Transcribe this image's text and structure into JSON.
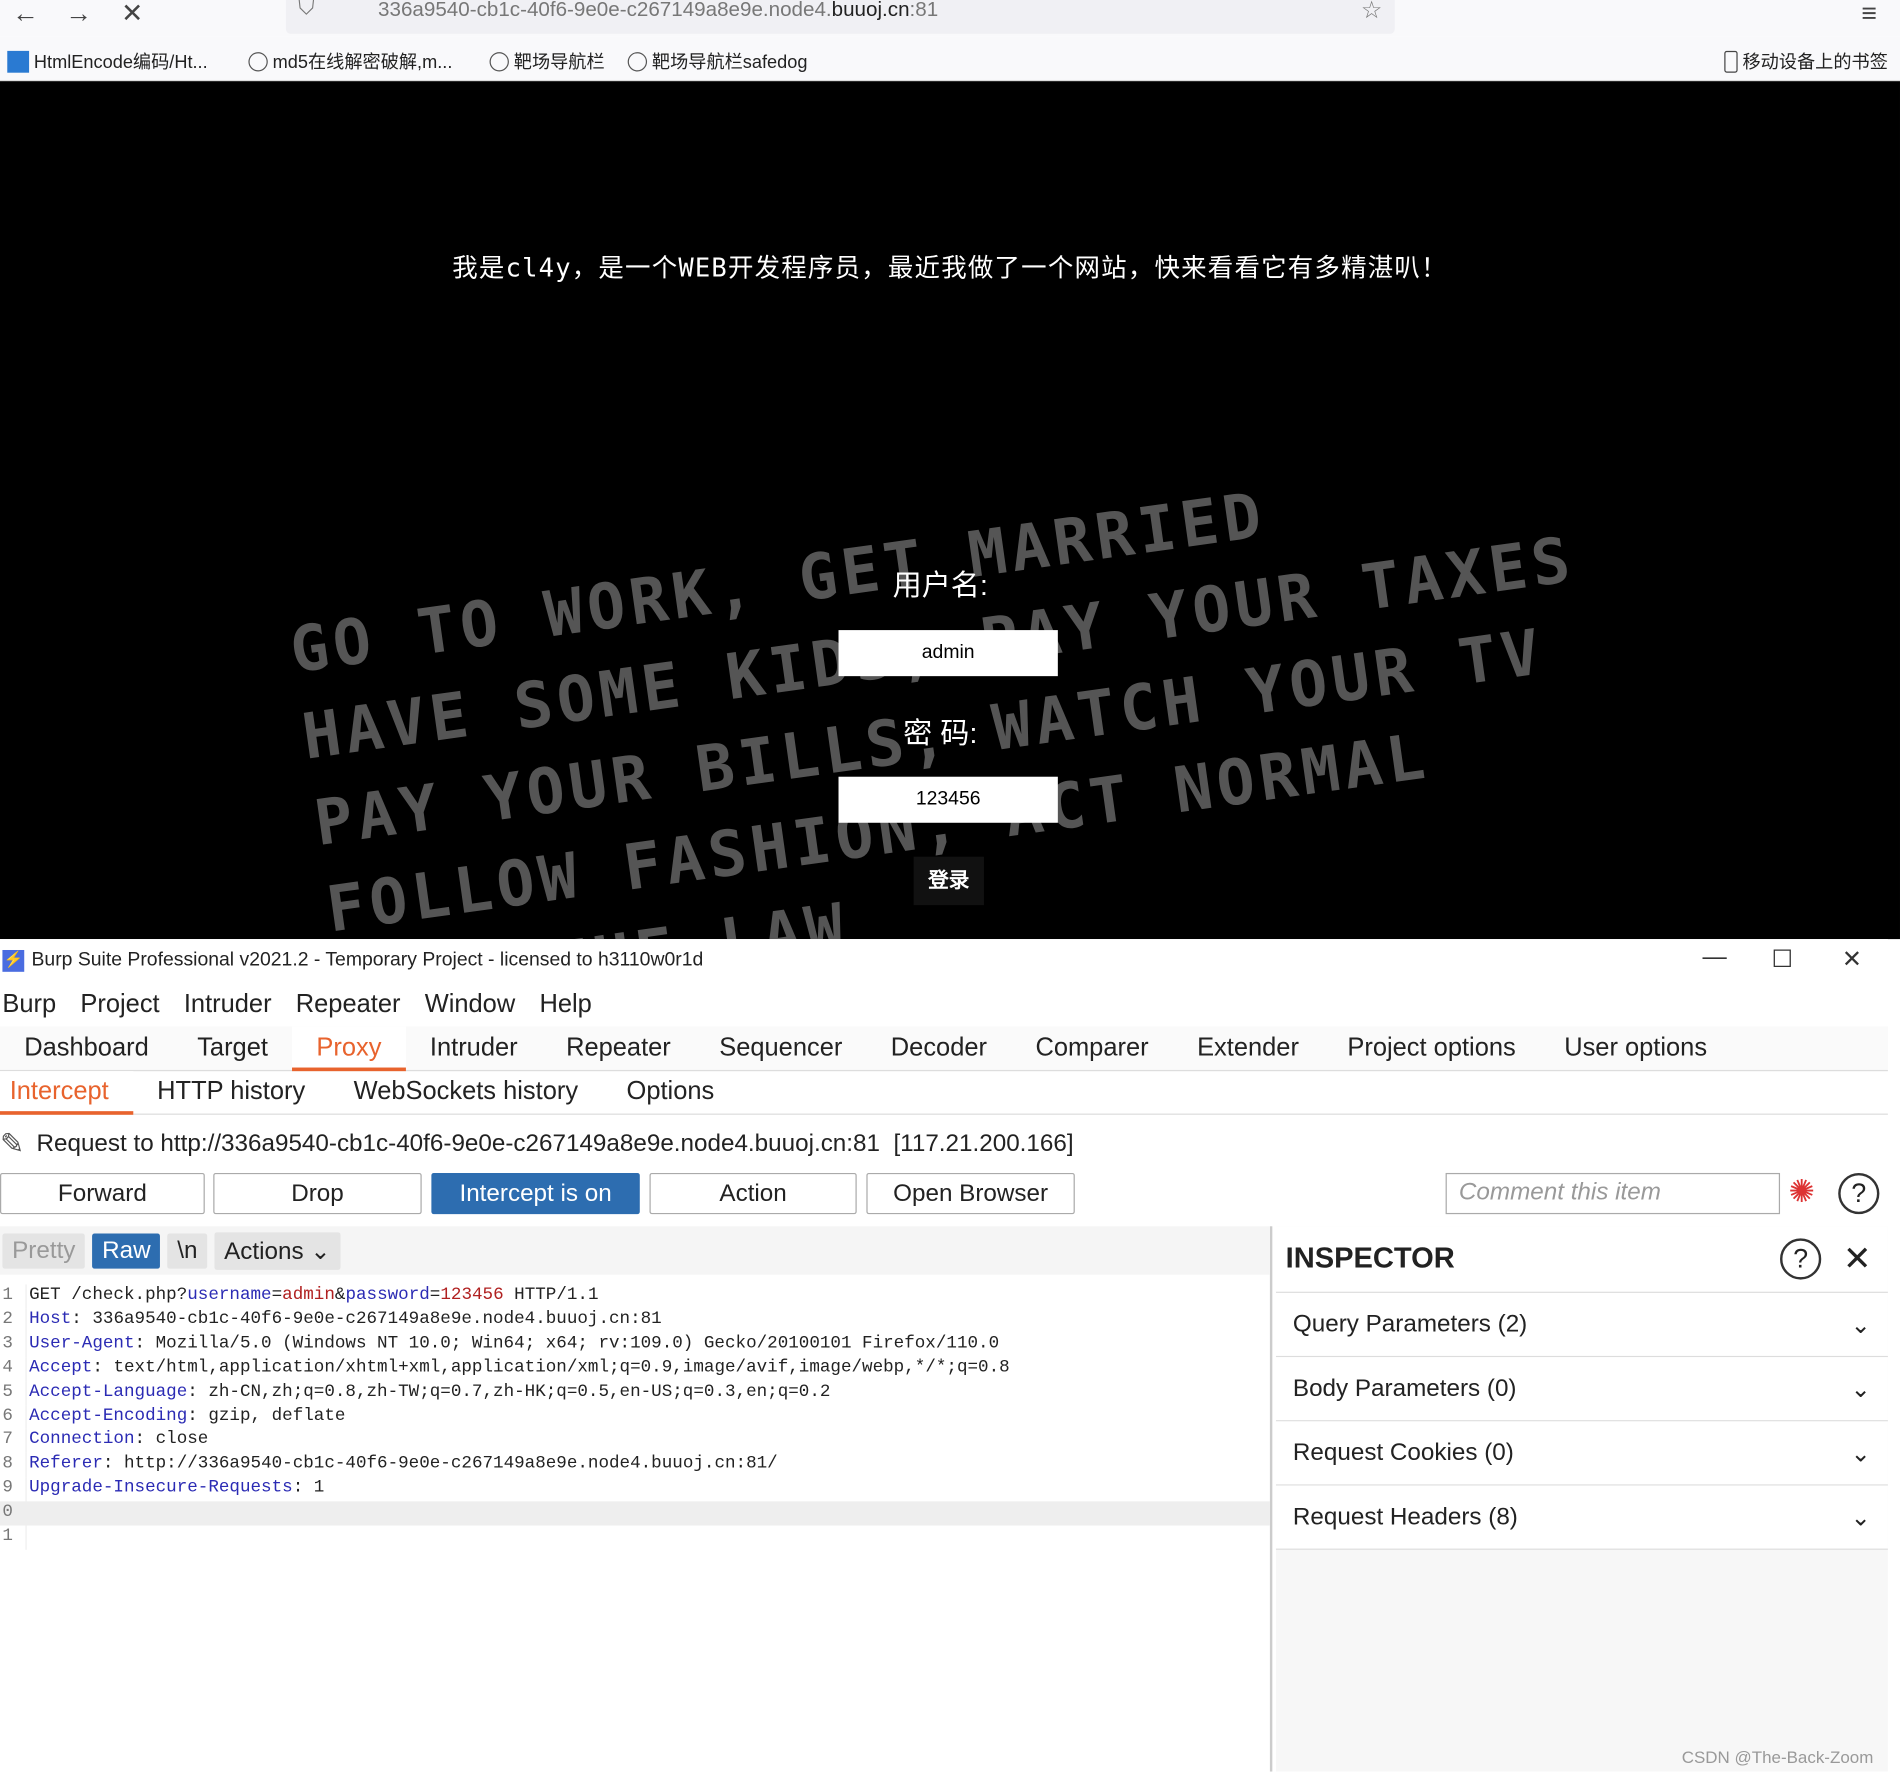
{
  "browser": {
    "url_prefix": "336a9540-cb1c-40f6-9e0e-c267149a8e9e.node4.",
    "url_domain": "buuoj.cn",
    "url_suffix": ":81",
    "bookmarks": [
      "HtmlEncode编码/Ht...",
      "md5在线解密破解,m...",
      "靶场导航栏",
      "靶场导航栏safedog"
    ],
    "mobile_bookmarks": "移动设备上的书签"
  },
  "page": {
    "slogan": "我是cl4y，是一个WEB开发程序员，最近我做了一个网站，快来看看它有多精湛叭！",
    "bg_text": "GO TO WORK, GET MARRIED\nHAVE SOME KIDS, PAY YOUR TAXES\nPAY YOUR BILLS, WATCH YOUR TV\nFOLLOW FASHION, ACT NORMAL\nOBEY THE LAW",
    "username_label": "用户名:",
    "username_value": "admin",
    "password_label": "密 码:",
    "password_value": "123456",
    "login": "登录"
  },
  "burp": {
    "title": "Burp Suite Professional v2021.2 - Temporary Project - licensed to h3110w0r1d",
    "menu": [
      "Burp",
      "Project",
      "Intruder",
      "Repeater",
      "Window",
      "Help"
    ],
    "tabs": [
      "Dashboard",
      "Target",
      "Proxy",
      "Intruder",
      "Repeater",
      "Sequencer",
      "Decoder",
      "Comparer",
      "Extender",
      "Project options",
      "User options"
    ],
    "active_tab": "Proxy",
    "subtabs": [
      "Intercept",
      "HTTP history",
      "WebSockets history",
      "Options"
    ],
    "request_to": "Request to http://336a9540-cb1c-40f6-9e0e-c267149a8e9e.node4.buuoj.cn:81  [117.21.200.166]",
    "buttons": {
      "forward": "Forward",
      "drop": "Drop",
      "intercept": "Intercept is on",
      "action": "Action",
      "open_browser": "Open Browser"
    },
    "comment_placeholder": "Comment this item",
    "editor_tools": {
      "pretty": "Pretty",
      "raw": "Raw",
      "newline": "\\n",
      "actions": "Actions"
    },
    "request": {
      "method_line": [
        "GET /check.php?",
        "username",
        "=",
        "admin",
        "&",
        "password",
        "=",
        "123456",
        " HTTP/1.1"
      ],
      "headers": [
        [
          "Host",
          "336a9540-cb1c-40f6-9e0e-c267149a8e9e.node4.buuoj.cn:81"
        ],
        [
          "User-Agent",
          "Mozilla/5.0 (Windows NT 10.0; Win64; x64; rv:109.0) Gecko/20100101 Firefox/110.0"
        ],
        [
          "Accept",
          "text/html,application/xhtml+xml,application/xml;q=0.9,image/avif,image/webp,*/*;q=0.8"
        ],
        [
          "Accept-Language",
          "zh-CN,zh;q=0.8,zh-TW;q=0.7,zh-HK;q=0.5,en-US;q=0.3,en;q=0.2"
        ],
        [
          "Accept-Encoding",
          "gzip, deflate"
        ],
        [
          "Connection",
          "close"
        ],
        [
          "Referer",
          "http://336a9540-cb1c-40f6-9e0e-c267149a8e9e.node4.buuoj.cn:81/"
        ],
        [
          "Upgrade-Insecure-Requests",
          "1"
        ]
      ]
    },
    "inspector": {
      "title": "INSPECTOR",
      "sections": [
        "Query Parameters (2)",
        "Body Parameters (0)",
        "Request Cookies (0)",
        "Request Headers (8)"
      ]
    },
    "accent": "#e8632d",
    "button_blue": "#2d6db0"
  },
  "watermark": "CSDN @The-Back-Zoom"
}
